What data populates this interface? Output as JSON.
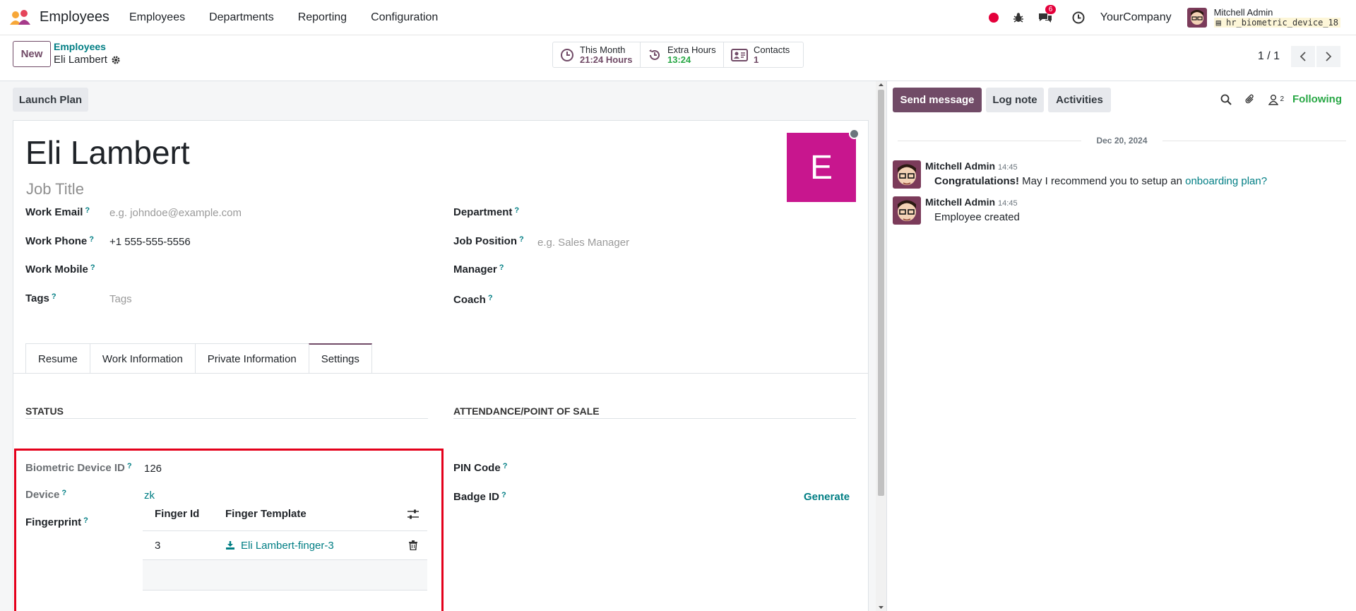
{
  "navbar": {
    "app_name": "Employees",
    "menu": [
      "Employees",
      "Departments",
      "Reporting",
      "Configuration"
    ],
    "message_count": "6",
    "company": "YourCompany",
    "user_name": "Mitchell Admin",
    "database": "hr_biometric_device_18"
  },
  "control": {
    "new_label": "New",
    "breadcrumb_parent": "Employees",
    "breadcrumb_current": "Eli Lambert",
    "stats": [
      {
        "label": "This Month",
        "value": "21:24 Hours"
      },
      {
        "label": "Extra Hours",
        "value": "13:24"
      },
      {
        "label": "Contacts",
        "value": "1"
      }
    ],
    "pager": "1 / 1"
  },
  "form": {
    "launch_plan": "Launch Plan",
    "name": "Eli Lambert",
    "job_title_placeholder": "Job Title",
    "avatar_letter": "E",
    "help_mark": "?",
    "fields_left": [
      {
        "label": "Work Email",
        "placeholder": "e.g. johndoe@example.com",
        "value": ""
      },
      {
        "label": "Work Phone",
        "placeholder": "",
        "value": "+1 555-555-5556"
      },
      {
        "label": "Work Mobile",
        "placeholder": "",
        "value": ""
      },
      {
        "label": "Tags",
        "placeholder": "Tags",
        "value": ""
      }
    ],
    "fields_right": [
      {
        "label": "Department",
        "placeholder": "",
        "value": ""
      },
      {
        "label": "Job Position",
        "placeholder": "e.g. Sales Manager",
        "value": ""
      },
      {
        "label": "Manager",
        "placeholder": "",
        "value": ""
      },
      {
        "label": "Coach",
        "placeholder": "",
        "value": ""
      }
    ],
    "tabs": [
      "Resume",
      "Work Information",
      "Private Information",
      "Settings"
    ],
    "active_tab": "Settings",
    "status_section": "STATUS",
    "attendance_section": "ATTENDANCE/POINT OF SALE",
    "biometric_label": "Biometric Device ID",
    "biometric_value": "126",
    "device_label": "Device",
    "device_value": "zk",
    "fingerprint_label": "Fingerprint",
    "fingerprint_table": {
      "headers": [
        "Finger Id",
        "Finger Template"
      ],
      "rows": [
        {
          "finger_id": "3",
          "template": "Eli Lambert-finger-3"
        }
      ]
    },
    "pin_label": "PIN Code",
    "badge_label": "Badge ID",
    "generate_label": "Generate"
  },
  "chatter": {
    "send_message": "Send message",
    "log_note": "Log note",
    "activities": "Activities",
    "followers_count": "2",
    "following": "Following",
    "date": "Dec 20, 2024",
    "messages": [
      {
        "author": "Mitchell Admin",
        "time": "14:45",
        "bold": "Congratulations!",
        "text": " May I recommend you to setup an ",
        "link": "onboarding plan?"
      },
      {
        "author": "Mitchell Admin",
        "time": "14:45",
        "text": "Employee created"
      }
    ]
  },
  "colors": {
    "brand": "#714b67",
    "link": "#017e84",
    "avatar": "#c8168e",
    "highlight": "#e4001b"
  }
}
